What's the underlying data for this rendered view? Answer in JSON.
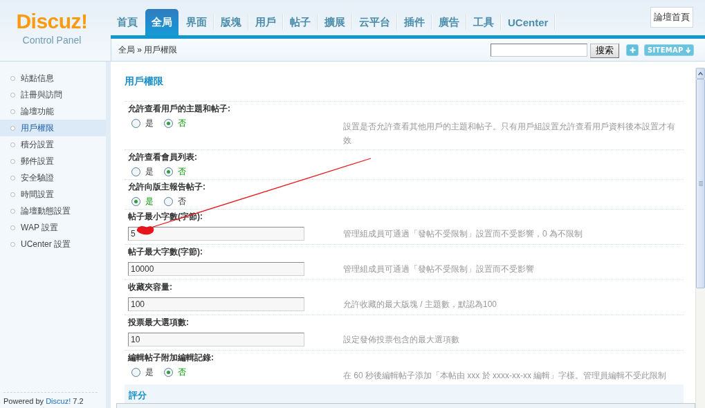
{
  "header": {
    "logo": {
      "name": "Discuz!",
      "subtitle": "Control Panel"
    },
    "nav_tabs": [
      {
        "label": "首頁",
        "selected": false
      },
      {
        "label": "全局",
        "selected": true
      },
      {
        "label": "界面",
        "selected": false
      },
      {
        "label": "版塊",
        "selected": false
      },
      {
        "label": "用戶",
        "selected": false
      },
      {
        "label": "帖子",
        "selected": false
      },
      {
        "label": "擴展",
        "selected": false
      },
      {
        "label": "云平台",
        "selected": false
      },
      {
        "label": "插件",
        "selected": false
      },
      {
        "label": "廣告",
        "selected": false
      },
      {
        "label": "工具",
        "selected": false
      },
      {
        "label": "UCenter",
        "selected": false
      }
    ],
    "home_button": "論壇首頁"
  },
  "toolbar": {
    "breadcrumb": "全局 » 用戶權限",
    "search_button": "搜索",
    "sitemap_button": "SITEMAP"
  },
  "sidebar": {
    "items": [
      {
        "label": "站點信息",
        "selected": false
      },
      {
        "label": "註冊與訪問",
        "selected": false
      },
      {
        "label": "論壇功能",
        "selected": false
      },
      {
        "label": "用戶權限",
        "selected": true
      },
      {
        "label": "積分設置",
        "selected": false
      },
      {
        "label": "郵件設置",
        "selected": false
      },
      {
        "label": "安全驗證",
        "selected": false
      },
      {
        "label": "時間設置",
        "selected": false
      },
      {
        "label": "論壇動態設置",
        "selected": false
      },
      {
        "label": "WAP 設置",
        "selected": false
      },
      {
        "label": "UCenter 設置",
        "selected": false
      }
    ],
    "footer": {
      "prefix": "Powered by",
      "link": "Discuz!",
      "suffix": "7.2"
    }
  },
  "main": {
    "title": "用戶權限",
    "settings": [
      {
        "kind": "radio",
        "label": "允許查看用戶的主題和帖子:",
        "options": [
          {
            "label": "是",
            "selected": false
          },
          {
            "label": "否",
            "selected": true
          }
        ],
        "comment": "設置是否允許查看其他用戶的主題和帖子。只有用戶組設置允許查看用戶資料後本設置才有效"
      },
      {
        "kind": "radio",
        "label": "允許查看會員列表:",
        "options": [
          {
            "label": "是",
            "selected": false
          },
          {
            "label": "否",
            "selected": true
          }
        ]
      },
      {
        "kind": "radio",
        "label": "允許向版主報告帖子:",
        "options": [
          {
            "label": "是",
            "selected": true
          },
          {
            "label": "否",
            "selected": false
          }
        ]
      },
      {
        "kind": "text",
        "label": "帖子最小字數(字節):",
        "value": "5",
        "comment": "管理組成員可通過「發帖不受限制」設置而不受影響，0 為不限制"
      },
      {
        "kind": "text",
        "label": "帖子最大字數(字節):",
        "value": "10000",
        "comment": "管理組成員可通過「發帖不受限制」設置而不受影響"
      },
      {
        "kind": "text",
        "label": "收藏夾容量:",
        "value": "100",
        "comment": "允許收藏的最大版塊 / 主題數，默認為100"
      },
      {
        "kind": "text",
        "label": "投票最大選項數:",
        "value": "10",
        "comment": "設定發佈投票包含的最大選項數"
      },
      {
        "kind": "radio",
        "label": "編輯帖子附加編輯記錄:",
        "options": [
          {
            "label": "是",
            "selected": false
          },
          {
            "label": "否",
            "selected": true
          }
        ],
        "comment": "在 60 秒後編輯帖子添加「本帖由 xxx 於 xxxx-xx-xx 編輯」字樣。管理員編輯不受此限制"
      }
    ],
    "next_section": "評分"
  }
}
